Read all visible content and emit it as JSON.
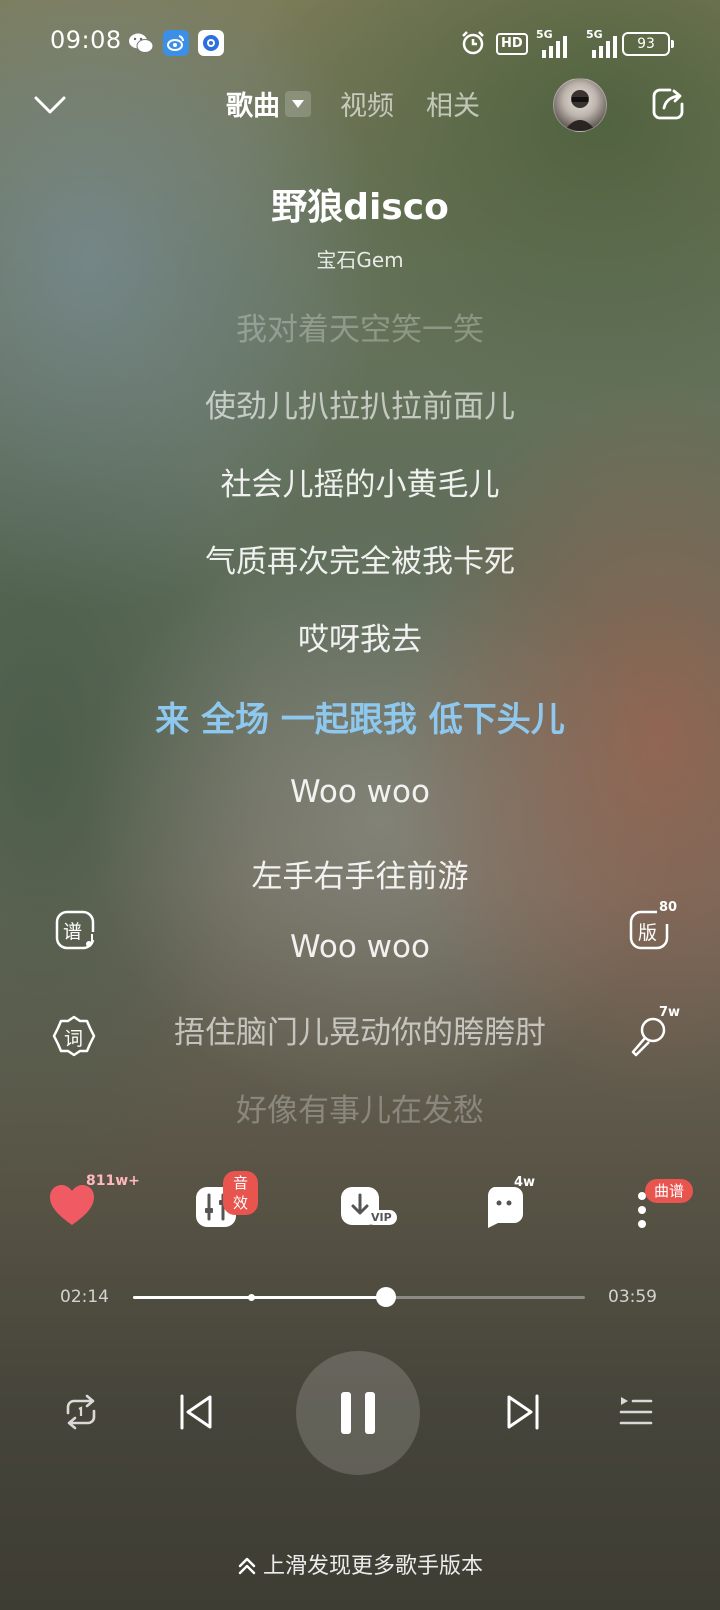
{
  "status_bar": {
    "time": "09:08",
    "icons": [
      "wechat-icon",
      "app-weibo-icon",
      "app-browser-icon"
    ],
    "right_icons": [
      "alarm-icon",
      "hd-icon",
      "signal-5g-icon",
      "signal-5g-icon"
    ],
    "network_1": "5G",
    "network_2": "5G",
    "hd": "HD",
    "battery": "93"
  },
  "header": {
    "tabs": [
      {
        "label": "歌曲",
        "active": true
      },
      {
        "label": "视频",
        "active": false
      },
      {
        "label": "相关",
        "active": false
      }
    ]
  },
  "song": {
    "title": "野狼disco",
    "artist": "宝石Gem"
  },
  "lyrics": [
    {
      "text": "我对着天空笑一笑",
      "state": "faded"
    },
    {
      "text": "使劲儿扒拉扒拉前面儿",
      "state": "dim"
    },
    {
      "text": "社会儿摇的小黄毛儿",
      "state": "normal"
    },
    {
      "text": "气质再次完全被我卡死",
      "state": "normal"
    },
    {
      "text": "哎呀我去",
      "state": "normal"
    },
    {
      "text": "来 全场 一起跟我 低下头儿",
      "state": "current"
    },
    {
      "text": "Woo woo",
      "state": "normal"
    },
    {
      "text": "左手右手往前游",
      "state": "normal"
    },
    {
      "text": "Woo woo",
      "state": "normal"
    },
    {
      "text": "捂住脑门儿晃动你的胯胯肘",
      "state": "dim"
    },
    {
      "text": "好像有事儿在发愁",
      "state": "faded"
    }
  ],
  "side_buttons": {
    "score_label": "谱",
    "lyrics_label": "词",
    "version_label": "版",
    "version_count": "80",
    "mic_count": "7w"
  },
  "actions": {
    "like_count": "811w+",
    "effects_badge": "音效",
    "download_badge": "VIP",
    "comment_count": "4w",
    "sheet_badge": "曲谱"
  },
  "progress": {
    "current": "02:14",
    "total": "03:59",
    "played_fraction": 0.56,
    "buffer_mark_fraction": 0.26
  },
  "controls": {
    "repeat": "repeat-icon",
    "prev": "prev-icon",
    "play_state": "pause-icon",
    "next": "next-icon",
    "playlist": "playlist-icon"
  },
  "hint": "上滑发现更多歌手版本",
  "colors": {
    "accent": "#8ec8ee",
    "like": "#ef5a63",
    "badge": "#e8544e"
  }
}
